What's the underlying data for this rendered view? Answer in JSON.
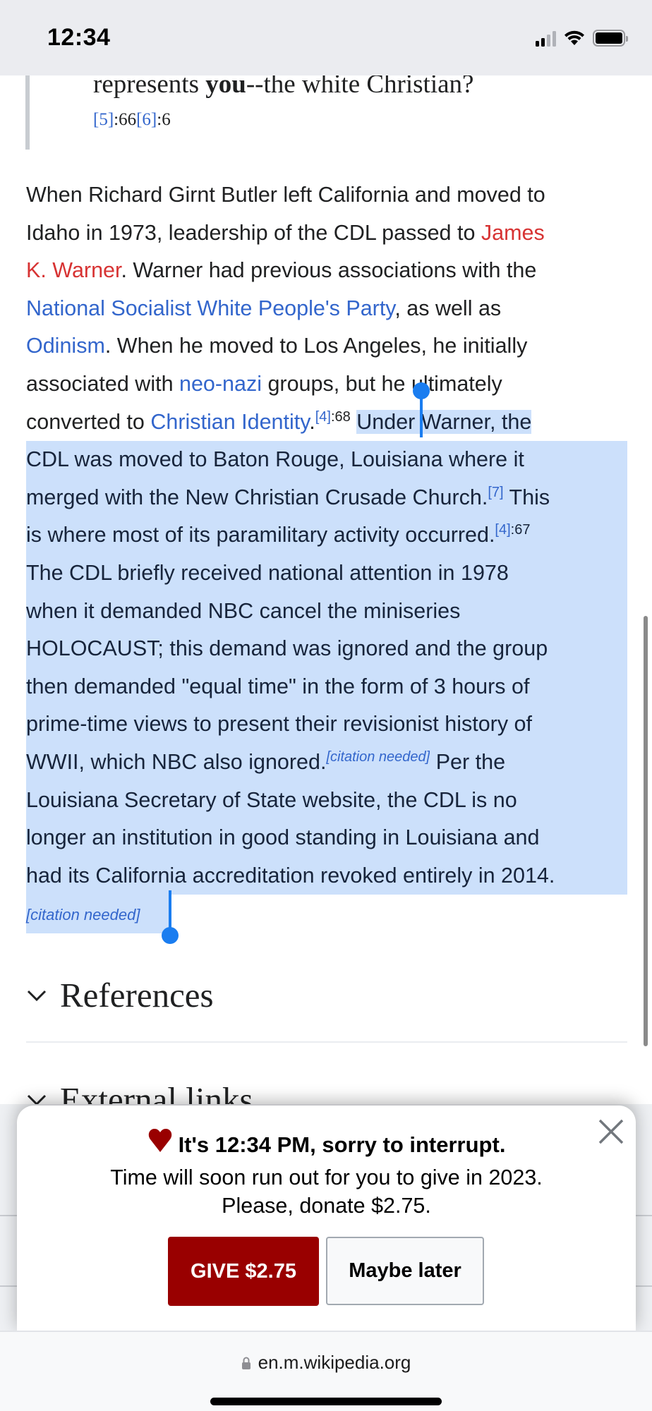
{
  "status_bar": {
    "time": "12:34",
    "icons": [
      "cellular-signal-icon",
      "wifi-icon",
      "battery-icon"
    ]
  },
  "article": {
    "quote": {
      "prefix": "represents ",
      "bold": "you",
      "suffix": "--the white Christian?",
      "refs": [
        {
          "label": "[5]",
          "page": ":66"
        },
        {
          "label": "[6]",
          "page": ":6"
        }
      ]
    },
    "paragraph": {
      "lines": [
        [
          {
            "t": "When Richard Girnt Butler left California and moved to"
          }
        ],
        [
          {
            "t": "Idaho in 1973, leadership of the CDL passed to "
          },
          {
            "t": "James",
            "link": "red"
          }
        ],
        [
          {
            "t": "K. Warner",
            "link": "red"
          },
          {
            "t": ". Warner had previous associations with the"
          }
        ],
        [
          {
            "t": "National Socialist White People's Party",
            "link": "blue"
          },
          {
            "t": ", as well as"
          }
        ],
        [
          {
            "t": "Odinism",
            "link": "blue"
          },
          {
            "t": ". When he moved to Los Angeles, he initially"
          }
        ],
        [
          {
            "t": "associated with "
          },
          {
            "t": "neo-nazi",
            "link": "blue"
          },
          {
            "t": " groups, but he ultimately"
          }
        ],
        [
          {
            "t": "converted to "
          },
          {
            "t": "Christian Identity",
            "link": "blue"
          },
          {
            "t": "."
          },
          {
            "sup": "[4]",
            "supref": true
          },
          {
            "sup": ":68"
          },
          {
            "t": " "
          },
          {
            "t": "Under Warner, the",
            "sel": true
          }
        ],
        [
          {
            "t": "CDL was moved to ",
            "sel": true
          },
          {
            "t": "Baton Rouge",
            "link": "blue",
            "sel": true
          },
          {
            "t": ", Louisiana where it",
            "sel": true
          }
        ],
        [
          {
            "t": "merged with the New Christian Crusade Church.",
            "sel": true
          },
          {
            "sup": "[7]",
            "supref": true,
            "sel": true
          },
          {
            "t": " This",
            "sel": true
          }
        ],
        [
          {
            "t": "is where most of its paramilitary activity occurred.",
            "sel": true
          },
          {
            "sup": "[4]",
            "supref": true,
            "sel": true
          },
          {
            "sup": ":67",
            "sel": true
          }
        ],
        [
          {
            "t": "The CDL briefly received national attention in 1978",
            "sel": true
          }
        ],
        [
          {
            "t": "when it demanded NBC cancel the miniseries",
            "sel": true
          }
        ],
        [
          {
            "t": "HOLOCAUST; this demand was ignored and the group",
            "sel": true
          }
        ],
        [
          {
            "t": "then demanded \"equal time\" in the form of 3 hours of",
            "sel": true
          }
        ],
        [
          {
            "t": "prime-time views to present their revisionist history of",
            "sel": true
          }
        ],
        [
          {
            "t": "WWII, which NBC also ignored.",
            "sel": true
          },
          {
            "sup": "[citation needed]",
            "cite": true,
            "sel": true
          },
          {
            "t": " Per the",
            "sel": true
          }
        ],
        [
          {
            "t": "Louisiana Secretary of State website, the CDL is no",
            "sel": true
          }
        ],
        [
          {
            "t": "longer an institution in good standing in Louisiana and",
            "sel": true
          }
        ],
        [
          {
            "t": "had its California accreditation revoked entirely in 2014.",
            "sel": true
          }
        ],
        [
          {
            "sup": "[citation needed]",
            "cite": true,
            "sel": true,
            "small": true
          }
        ]
      ]
    },
    "sections": [
      {
        "title": "References",
        "icon": "chevron-down-icon"
      },
      {
        "title": "External links",
        "icon": "chevron-down-icon"
      }
    ]
  },
  "banner": {
    "headline": "It's 12:34 PM, sorry to interrupt.",
    "line1": "Time will soon run out for you to give in 2023.",
    "line2": "Please, donate $2.75.",
    "give_label": "GIVE $2.75",
    "later_label": "Maybe later",
    "accent_color": "#990000"
  },
  "browser": {
    "url": "en.m.wikipedia.org"
  },
  "colors": {
    "link_blue": "#3366cc",
    "link_red": "#d73333",
    "selection": "#cce0fb",
    "selection_handle": "#1a7df0"
  }
}
